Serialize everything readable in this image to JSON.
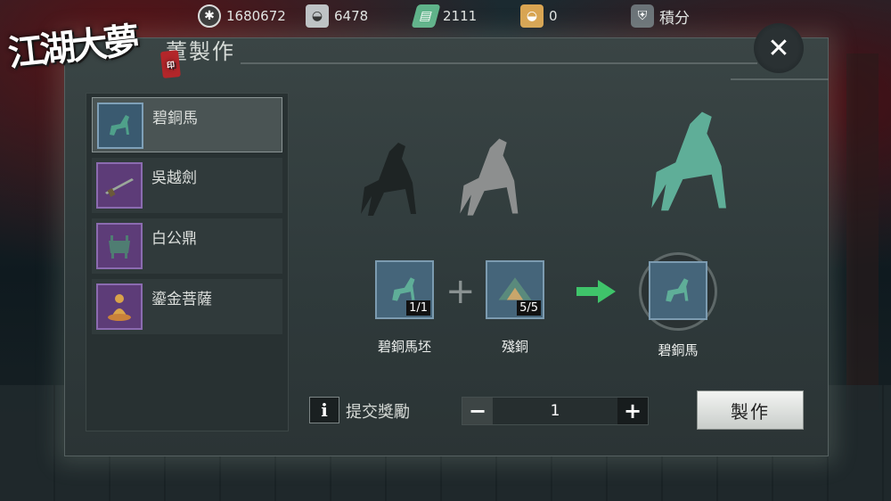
{
  "resources": [
    {
      "icon": "film-reel-icon",
      "value": "1680672"
    },
    {
      "icon": "silver-ingot-icon",
      "value": "6478"
    },
    {
      "icon": "jade-ticket-icon",
      "value": "2111"
    },
    {
      "icon": "gold-ingot-icon",
      "value": "0"
    },
    {
      "icon": "shield-points-icon",
      "value": "積分"
    }
  ],
  "logo": {
    "text": "江湖大夢",
    "seal": "印"
  },
  "dialog": {
    "title": "董製作",
    "close_label": "✕"
  },
  "items": [
    {
      "label": "碧銅馬",
      "selected": true
    },
    {
      "label": "吳越劍",
      "selected": false
    },
    {
      "label": "白公鼎",
      "selected": false
    },
    {
      "label": "鎏金菩薩",
      "selected": false
    }
  ],
  "recipe": {
    "inputs": [
      {
        "label": "碧銅馬坯",
        "count": "1/1"
      },
      {
        "label": "殘銅",
        "count": "5/5"
      }
    ],
    "output": {
      "label": "碧銅馬"
    }
  },
  "bottom": {
    "info_label": "i",
    "reward_label": "提交獎勵",
    "quantity": "1",
    "minus": "−",
    "plus": "+",
    "make_label": "製作"
  },
  "colors": {
    "accent_green": "#3fc46a",
    "panel": "#2f3a3b",
    "item_purple": "#5d3c78",
    "item_blue": "#45657a"
  }
}
